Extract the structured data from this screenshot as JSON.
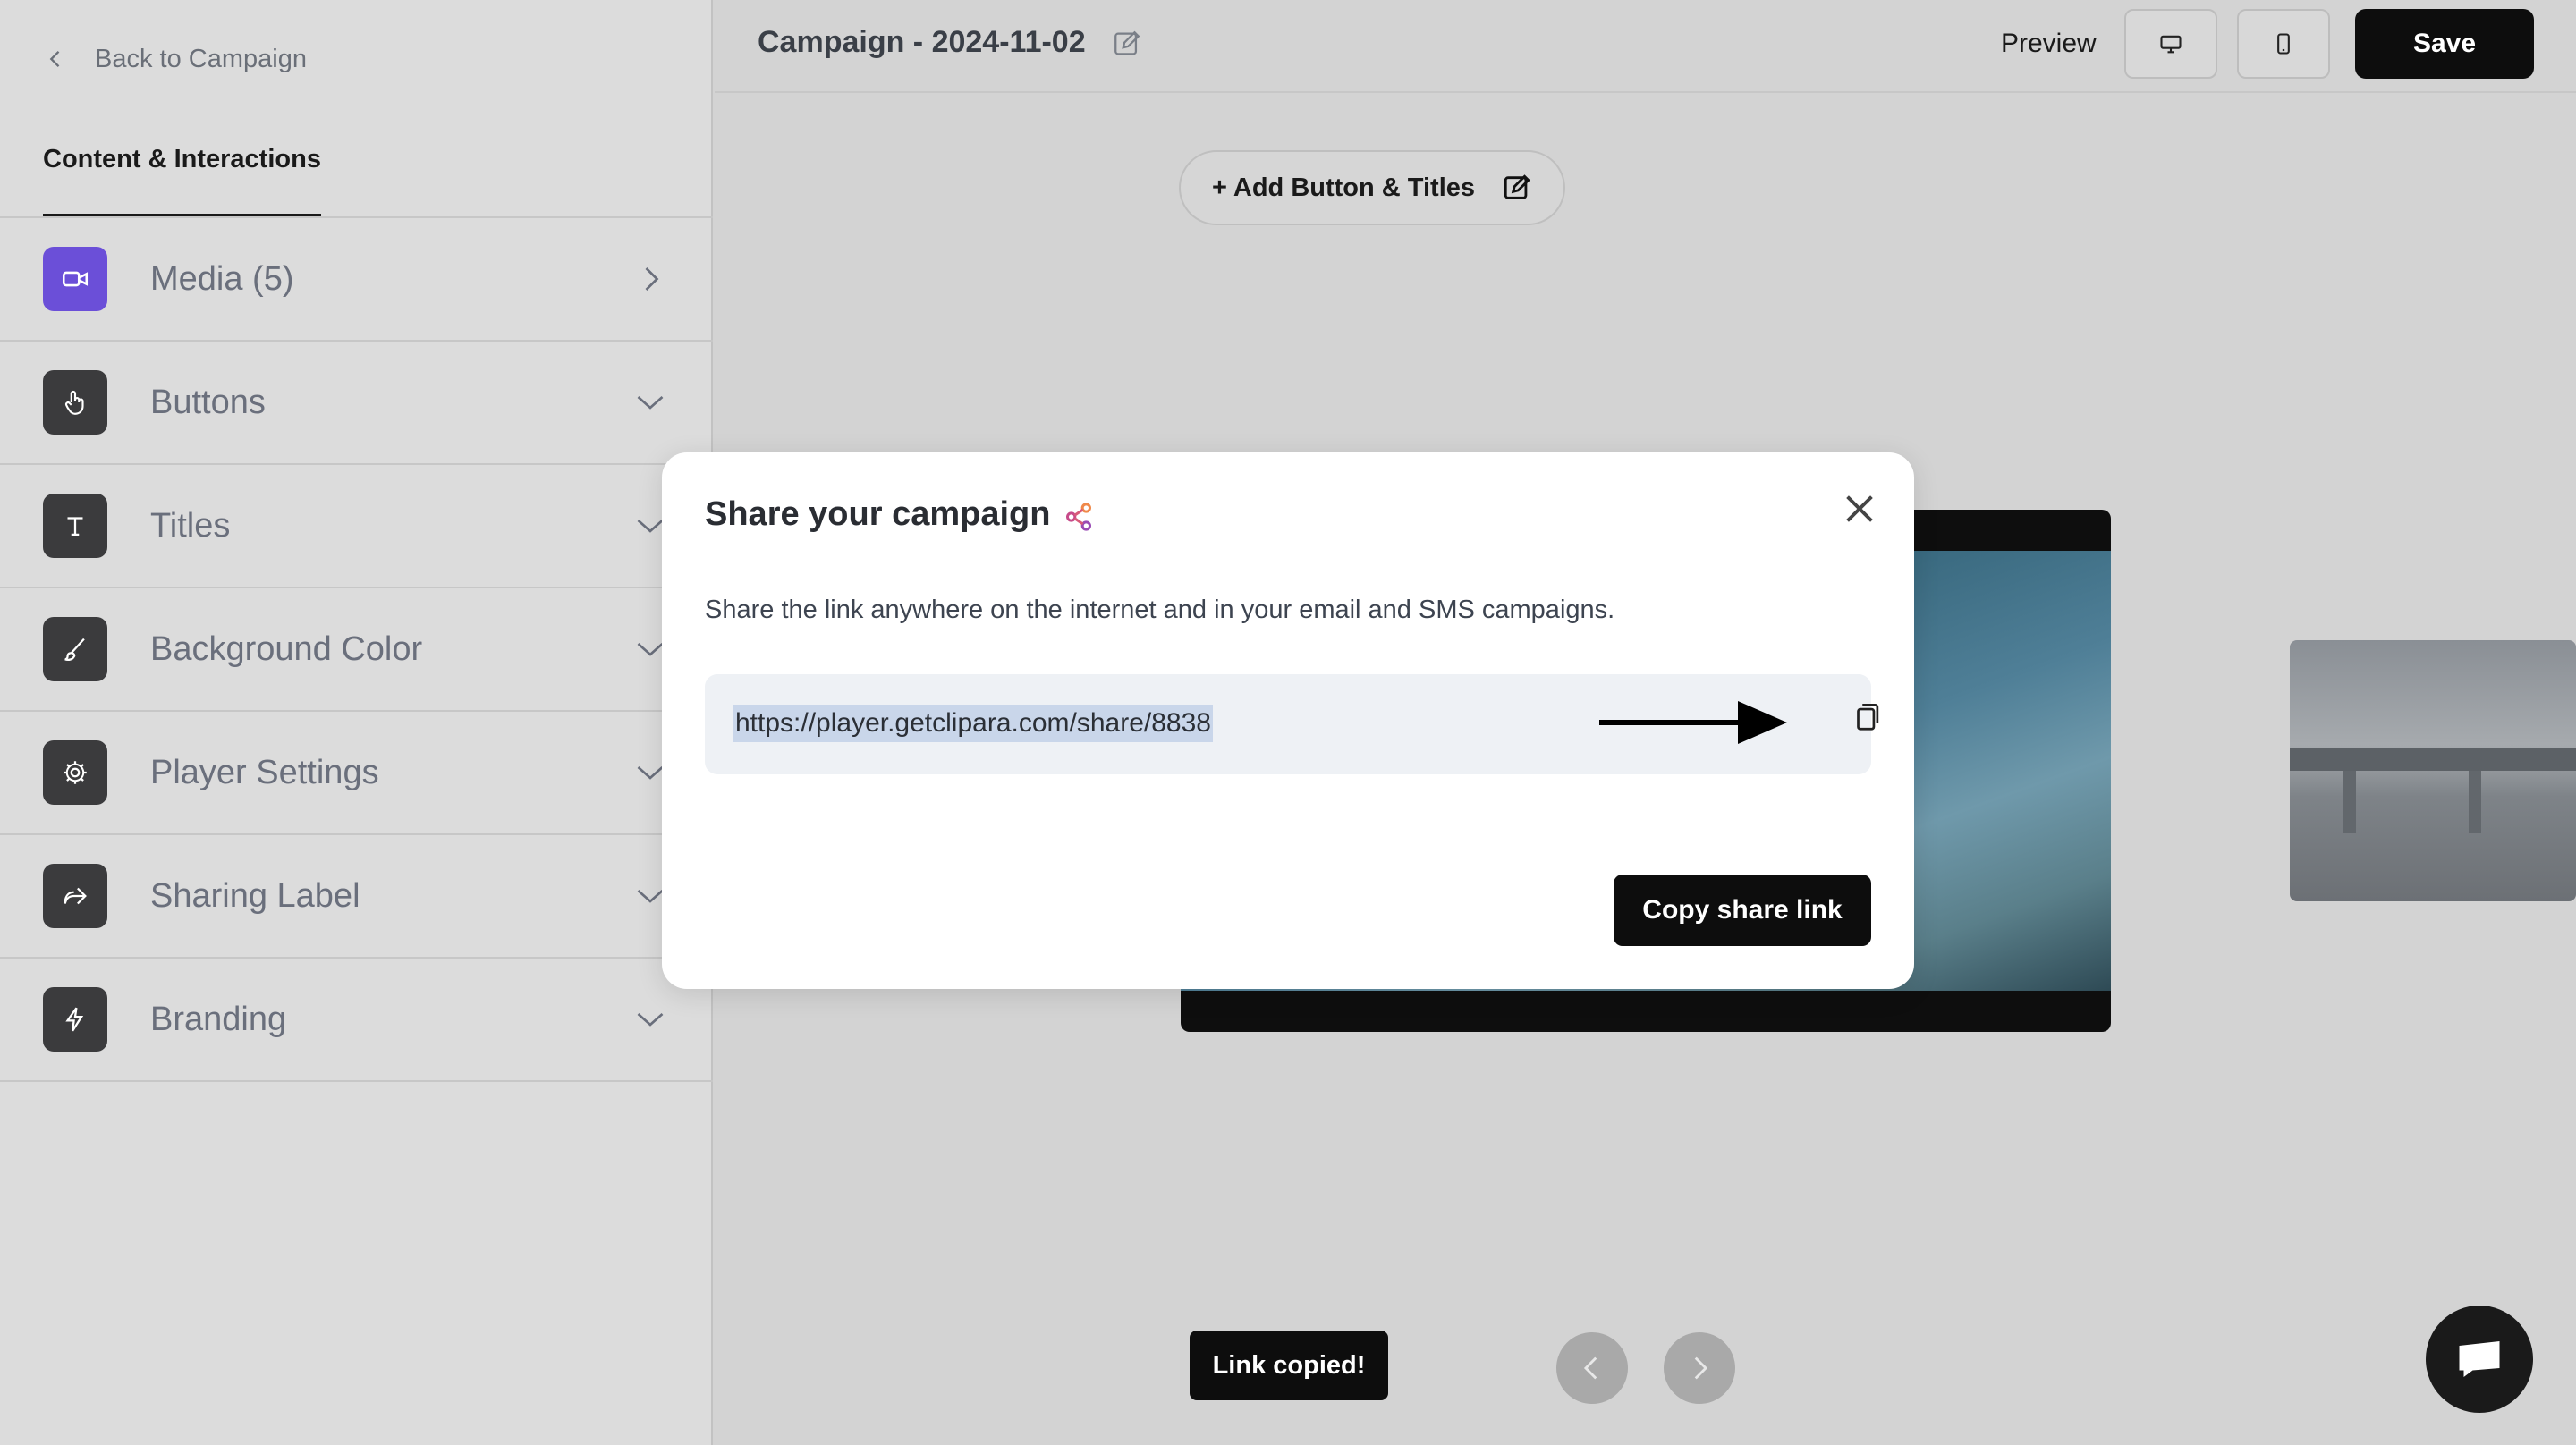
{
  "sidebar": {
    "back_label": "Back to Campaign",
    "tab_label": "Content & Interactions",
    "items": [
      {
        "label": "Media (5)",
        "icon": "video-camera-icon"
      },
      {
        "label": "Buttons",
        "icon": "pointer-hand-icon"
      },
      {
        "label": "Titles",
        "icon": "text-t-icon"
      },
      {
        "label": "Background Color",
        "icon": "brush-icon"
      },
      {
        "label": "Player Settings",
        "icon": "gear-icon"
      },
      {
        "label": "Sharing Label",
        "icon": "share-forward-icon"
      },
      {
        "label": "Branding",
        "icon": "lightning-icon"
      }
    ]
  },
  "topbar": {
    "title": "Campaign - 2024-11-02",
    "preview_label": "Preview",
    "save_label": "Save"
  },
  "canvas": {
    "add_button_label": "+ Add Button & Titles",
    "toast": "Link copied!"
  },
  "modal": {
    "title": "Share your campaign",
    "description": "Share the link anywhere on the internet and in your email and SMS campaigns.",
    "link": "https://player.getclipara.com/share/8838",
    "copy_button": "Copy share link"
  },
  "colors": {
    "media_icon_bg": "#6b4fd8",
    "share_icon_accent": "#e8558b",
    "primary_button": "#0d0d0d"
  }
}
